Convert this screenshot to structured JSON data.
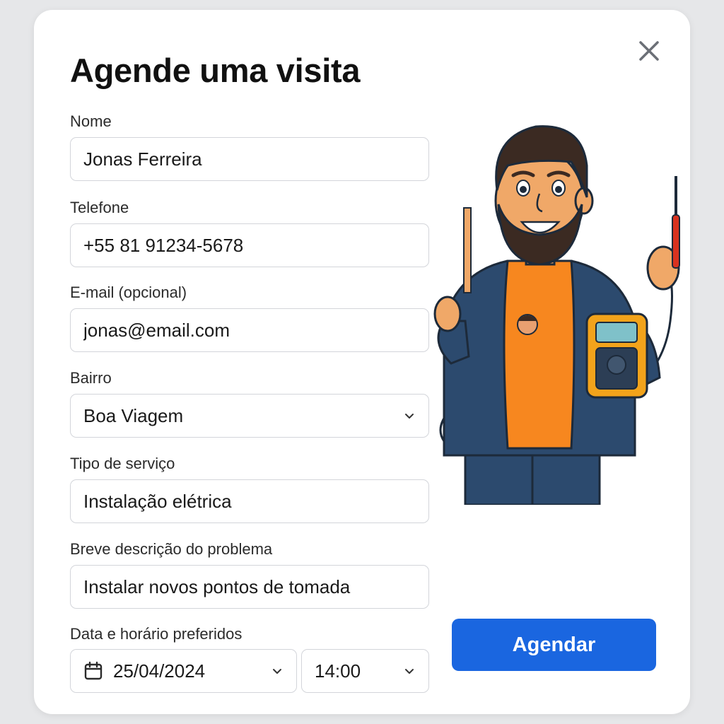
{
  "modal": {
    "title": "Agende uma visita",
    "close_icon": "close-icon"
  },
  "form": {
    "name": {
      "label": "Nome",
      "value": "Jonas Ferreira"
    },
    "phone": {
      "label": "Telefone",
      "value": "+55 81 91234-5678"
    },
    "email": {
      "label": "E-mail (opcional)",
      "value": "jonas@email.com"
    },
    "neighborhood": {
      "label": "Bairro",
      "value": "Boa Viagem"
    },
    "service_type": {
      "label": "Tipo de serviço",
      "value": "Instalação elétrica"
    },
    "description": {
      "label": "Breve descrição do problema",
      "value": "Instalar novos pontos de tomada"
    },
    "schedule": {
      "label": "Data e horário preferidos",
      "date": "25/04/2024",
      "time": "14:00"
    }
  },
  "actions": {
    "submit_label": "Agendar"
  },
  "colors": {
    "accent": "#1a66e0",
    "shirt": "#f7871f",
    "jacket": "#2c4a6e",
    "meter": "#f2a31b"
  },
  "illustration": {
    "subject": "electrician holding screwdriver and multimeter"
  }
}
